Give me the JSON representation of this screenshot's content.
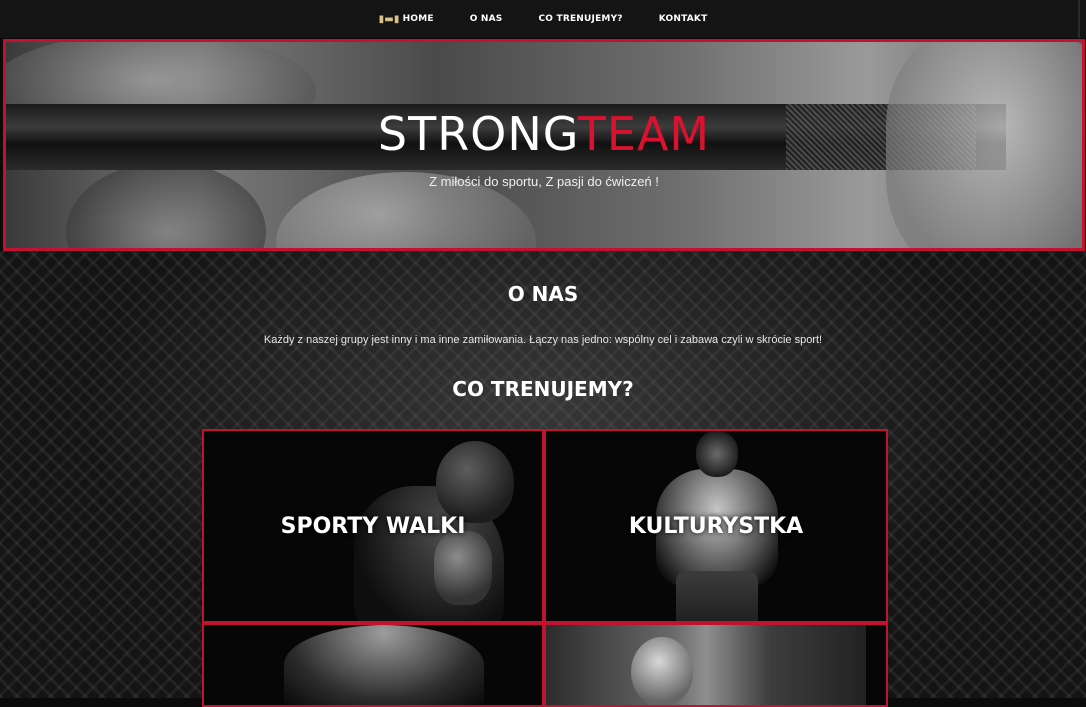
{
  "nav": {
    "items": [
      {
        "label": "HOME",
        "icon": "dumbbell-icon"
      },
      {
        "label": "O NAS"
      },
      {
        "label": "CO TRENUJEMY?"
      },
      {
        "label": "KONTAKT"
      }
    ]
  },
  "hero": {
    "title_part1": "STRONG",
    "title_part2": "TEAM",
    "subtitle": "Z miłości do sportu, Z pasji do ćwiczeń !"
  },
  "about": {
    "title": "O NAS",
    "text": "Każdy z naszej grupy jest inny i ma inne zamiłowania. Łączy nas jedno: wspólny cel i zabawa czyli w skrócie sport!"
  },
  "training": {
    "title": "CO TRENUJEMY?",
    "tiles": [
      {
        "label": "SPORTY WALKI"
      },
      {
        "label": "KULTURYSTKA"
      },
      {
        "label": ""
      },
      {
        "label": ""
      }
    ]
  },
  "colors": {
    "accent": "#c1122f",
    "nav_bg": "#141414",
    "title_red": "#d9132f"
  }
}
